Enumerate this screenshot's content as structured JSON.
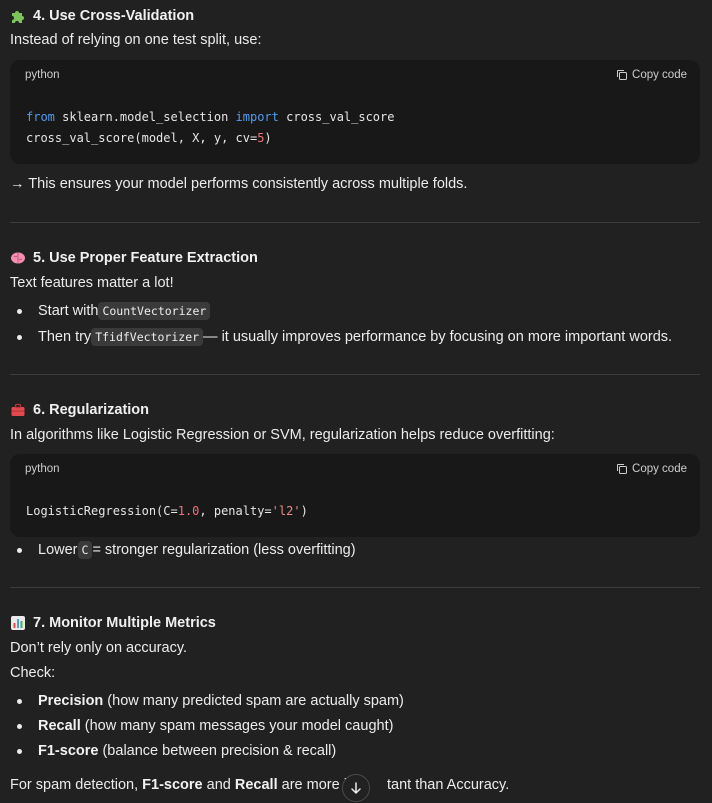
{
  "sections": {
    "s4": {
      "title": "4. Use Cross-Validation",
      "icon": "puzzle-icon",
      "intro": "Instead of relying on one test split, use:",
      "code": {
        "lang": "python",
        "copy_label": "Copy code",
        "line1_kw1": "from",
        "line1_mod": " sklearn.model_selection ",
        "line1_kw2": "import",
        "line1_rest": " cross_val_score",
        "line2_pre": "cross_val_score(model, X, y, cv=",
        "line2_num": "5",
        "line2_post": ")"
      },
      "after": "→ This ensures your model performs consistently across multiple folds."
    },
    "s5": {
      "title": "5. Use Proper Feature Extraction",
      "icon": "brain-icon",
      "intro": "Text features matter a lot!",
      "bullet1_pre": "Start with ",
      "bullet1_code": "CountVectorizer",
      "bullet2_pre": "Then try ",
      "bullet2_code": "TfidfVectorizer",
      "bullet2_post": " — it usually improves performance by focusing on more important words."
    },
    "s6": {
      "title": "6. Regularization",
      "icon": "toolbox-icon",
      "intro": "In algorithms like Logistic Regression or SVM, regularization helps reduce overfitting:",
      "code": {
        "lang": "python",
        "copy_label": "Copy code",
        "line1_pre": "LogisticRegression(C=",
        "line1_num": "1.0",
        "line1_mid": ", penalty=",
        "line1_str": "'l2'",
        "line1_post": ")"
      },
      "bullet1_pre": "Lower ",
      "bullet1_code": "C",
      "bullet1_post": " = stronger regularization (less overfitting)"
    },
    "s7": {
      "title": "7. Monitor Multiple Metrics",
      "icon": "bar-chart-icon",
      "intro1": "Don’t rely only on accuracy.",
      "intro2": "Check:",
      "bullets": [
        {
          "bold": "Precision",
          "rest": " (how many predicted spam are actually spam)"
        },
        {
          "bold": "Recall",
          "rest": " (how many spam messages your model caught)"
        },
        {
          "bold": "F1-score",
          "rest": " (balance between precision & recall)"
        }
      ],
      "final_pre": "For spam detection, ",
      "final_b1": "F1-score",
      "final_mid": " and ",
      "final_b2": "Recall",
      "final_post": " are more im",
      "final_tail": "tant than Accuracy."
    }
  },
  "colors": {
    "background": "#212121",
    "code_bg": "#181818",
    "keyword": "#4f9cf0",
    "number": "#f07178"
  }
}
